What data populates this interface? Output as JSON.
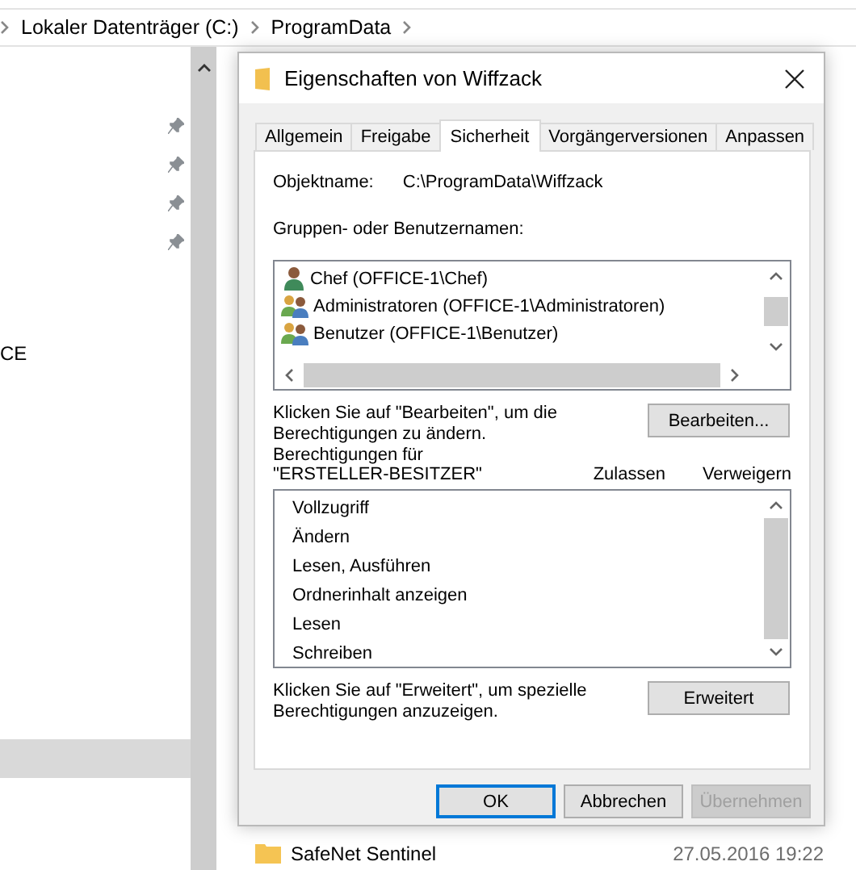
{
  "explorer": {
    "breadcrumb": [
      "Lokaler Datenträger (C:)",
      "ProgramData"
    ],
    "nav_label": "CE",
    "files": [
      {
        "name": "SafeNet Sentinel",
        "date": "27.05.2016 19:22"
      }
    ]
  },
  "dialog": {
    "title": "Eigenschaften von Wiffzack",
    "tabs": [
      {
        "label": "Allgemein",
        "selected": false
      },
      {
        "label": "Freigabe",
        "selected": false
      },
      {
        "label": "Sicherheit",
        "selected": true
      },
      {
        "label": "Vorgängerversionen",
        "selected": false
      },
      {
        "label": "Anpassen",
        "selected": false
      }
    ],
    "object_label": "Objektname:",
    "object_name": "C:\\ProgramData\\Wiffzack",
    "groups_label": "Gruppen- oder Benutzernamen:",
    "groups": [
      {
        "kind": "user",
        "name": "Chef (OFFICE-1\\Chef)"
      },
      {
        "kind": "group",
        "name": "Administratoren (OFFICE-1\\Administratoren)"
      },
      {
        "kind": "group",
        "name": "Benutzer (OFFICE-1\\Benutzer)"
      }
    ],
    "edit_hint": "Klicken Sie auf \"Bearbeiten\", um die Berechtigungen zu ändern.",
    "edit_button": "Bearbeiten...",
    "permissions_label": "Berechtigungen für",
    "permissions_for": "\"ERSTELLER-BESITZER\"",
    "columns": [
      "Zulassen",
      "Verweigern"
    ],
    "permissions": [
      "Vollzugriff",
      "Ändern",
      "Lesen, Ausführen",
      "Ordnerinhalt anzeigen",
      "Lesen",
      "Schreiben"
    ],
    "advanced_hint": "Klicken Sie auf \"Erweitert\", um spezielle Berechtigungen anzuzeigen.",
    "advanced_button": "Erweitert",
    "buttons": [
      {
        "label": "OK",
        "default": true,
        "disabled": false
      },
      {
        "label": "Abbrechen",
        "default": false,
        "disabled": false
      },
      {
        "label": "Übernehmen",
        "default": false,
        "disabled": true
      }
    ]
  }
}
